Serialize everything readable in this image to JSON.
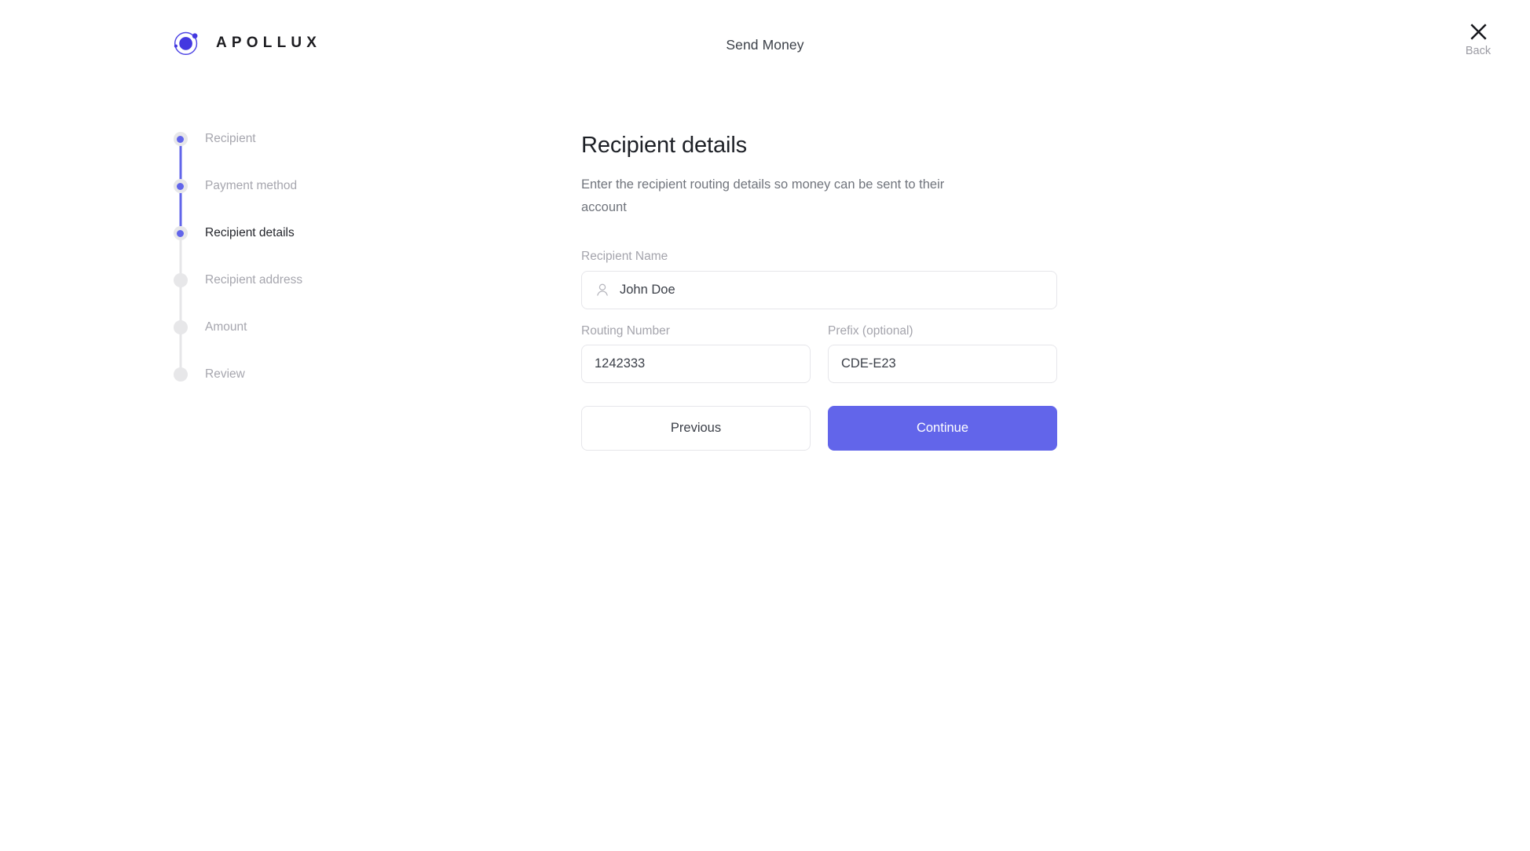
{
  "brand": {
    "name": "APOLLUX",
    "mark_icon": "atom-orbit-icon",
    "mark_color": "#4338e0"
  },
  "header": {
    "title": "Send Money",
    "back_label": "Back",
    "back_icon": "close-x-icon"
  },
  "stepper": {
    "steps": [
      {
        "label": "Recipient",
        "state": "complete"
      },
      {
        "label": "Payment method",
        "state": "complete"
      },
      {
        "label": "Recipient details",
        "state": "current"
      },
      {
        "label": "Recipient address",
        "state": "pending"
      },
      {
        "label": "Amount",
        "state": "pending"
      },
      {
        "label": "Review",
        "state": "pending"
      }
    ],
    "active_color": "#6265ea",
    "inactive_color": "#e7e7e9"
  },
  "main": {
    "title": "Recipient details",
    "subtitle": "Enter the recipient routing details so money can be sent to their account",
    "fields": {
      "recipient_name": {
        "label": "Recipient Name",
        "value": "John Doe",
        "placeholder": "Recipient Name",
        "icon": "person-icon"
      },
      "routing_number": {
        "label": "Routing Number",
        "value": "1242333",
        "placeholder": "Routing Number"
      },
      "prefix": {
        "label": "Prefix (optional)",
        "value": "CDE-E23",
        "placeholder": "Prefix (optional)"
      }
    },
    "actions": {
      "previous_label": "Previous",
      "continue_label": "Continue",
      "primary_color": "#6265ea"
    }
  }
}
